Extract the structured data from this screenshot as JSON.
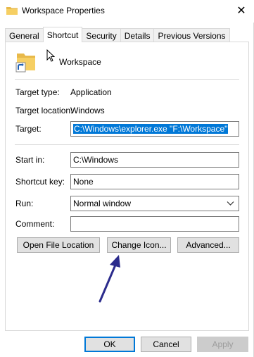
{
  "window": {
    "title": "Workspace Properties",
    "close_glyph": "✕"
  },
  "tabs": [
    {
      "label": "General",
      "active": false
    },
    {
      "label": "Shortcut",
      "active": true
    },
    {
      "label": "Security",
      "active": false
    },
    {
      "label": "Details",
      "active": false
    },
    {
      "label": "Previous Versions",
      "active": false
    }
  ],
  "shortcut": {
    "name": "Workspace",
    "target_type_label": "Target type:",
    "target_type_value": "Application",
    "target_location_label": "Target location:",
    "target_location_value": "Windows",
    "target_label": "Target:",
    "target_value": "C:\\Windows\\explorer.exe \"F:\\Workspace\"",
    "start_in_label": "Start in:",
    "start_in_value": "C:\\Windows",
    "shortcut_key_label": "Shortcut key:",
    "shortcut_key_value": "None",
    "run_label": "Run:",
    "run_value": "Normal window",
    "comment_label": "Comment:",
    "comment_value": "",
    "open_file_location": "Open File Location",
    "change_icon": "Change Icon...",
    "advanced": "Advanced..."
  },
  "footer": {
    "ok": "OK",
    "cancel": "Cancel",
    "apply": "Apply"
  },
  "colors": {
    "selection": "#0078d7",
    "annotation_arrow": "#2b2b8c"
  }
}
